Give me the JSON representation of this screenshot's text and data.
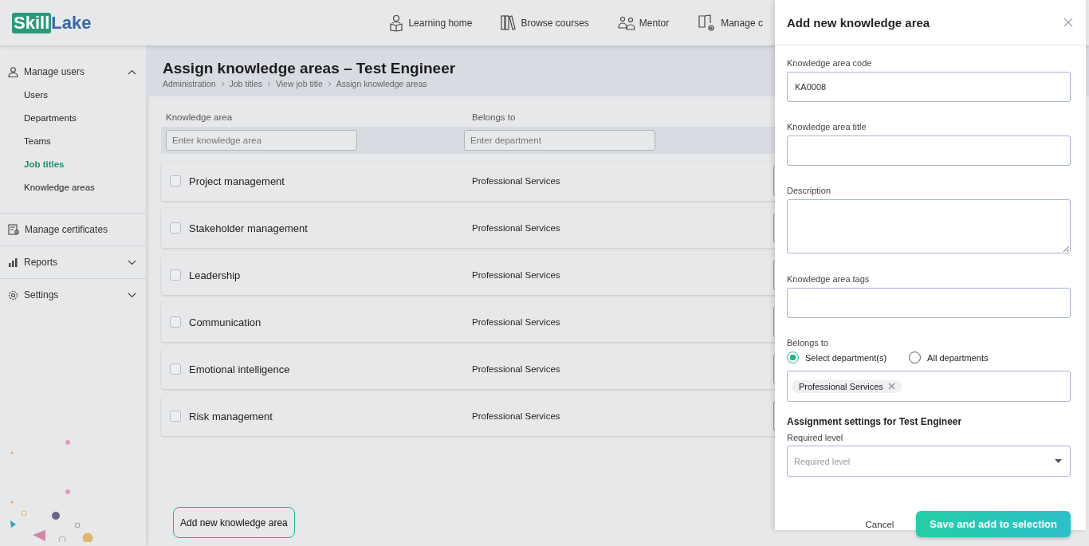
{
  "topbar": {
    "logo": {
      "boxed": "Skill",
      "plain": "Lake"
    },
    "nav": [
      {
        "label": "Learning home"
      },
      {
        "label": "Browse courses"
      },
      {
        "label": "Mentor"
      },
      {
        "label": "Manage c"
      }
    ]
  },
  "sidebar": {
    "sections": [
      {
        "label": "Manage users",
        "expanded": true,
        "children": [
          {
            "label": "Users",
            "selected": false
          },
          {
            "label": "Departments",
            "selected": false
          },
          {
            "label": "Teams",
            "selected": false
          },
          {
            "label": "Job titles",
            "selected": true
          },
          {
            "label": "Knowledge areas",
            "selected": false
          }
        ]
      },
      {
        "label": "Manage certificates"
      },
      {
        "label": "Reports",
        "expanded": false
      },
      {
        "label": "Settings",
        "expanded": false
      }
    ]
  },
  "page": {
    "title": "Assign knowledge areas – Test Engineer",
    "breadcrumbs": [
      "Administration",
      "Job titles",
      "View job title",
      "Assign knowledge areas"
    ]
  },
  "table": {
    "columns": [
      {
        "label": "Knowledge area",
        "placeholder": "Enter knowledge area"
      },
      {
        "label": "Belongs to",
        "placeholder": "Enter department"
      }
    ],
    "rows": [
      {
        "name": "Project management",
        "department": "Professional Services",
        "checked": false
      },
      {
        "name": "Stakeholder management",
        "department": "Professional Services",
        "checked": false
      },
      {
        "name": "Leadership",
        "department": "Professional Services",
        "checked": false
      },
      {
        "name": "Communication",
        "department": "Professional Services",
        "checked": false
      },
      {
        "name": "Emotional intelligence",
        "department": "Professional Services",
        "checked": false
      },
      {
        "name": "Risk management",
        "department": "Professional Services",
        "checked": false
      }
    ]
  },
  "add_button": "Add new knowledge area",
  "panel": {
    "title": "Add new knowledge area",
    "fields": [
      {
        "kind": "text",
        "label": "Knowledge area code",
        "value": "KA0008"
      },
      {
        "kind": "text",
        "label": "Knowledge area title"
      },
      {
        "kind": "textarea",
        "label": "Description"
      },
      {
        "kind": "text",
        "label": "Knowledge area tags"
      }
    ],
    "belongs_to": {
      "label": "Belongs to",
      "options": [
        {
          "label": "Select department(s)",
          "selected": true
        },
        {
          "label": "All departments",
          "selected": false
        }
      ],
      "tags": [
        "Professional Services"
      ]
    },
    "assignment": {
      "heading": "Assignment settings for Test Engineer",
      "label": "Required level",
      "placeholder": "Required level"
    },
    "cancel": "Cancel",
    "save": "Save and add to selection"
  }
}
